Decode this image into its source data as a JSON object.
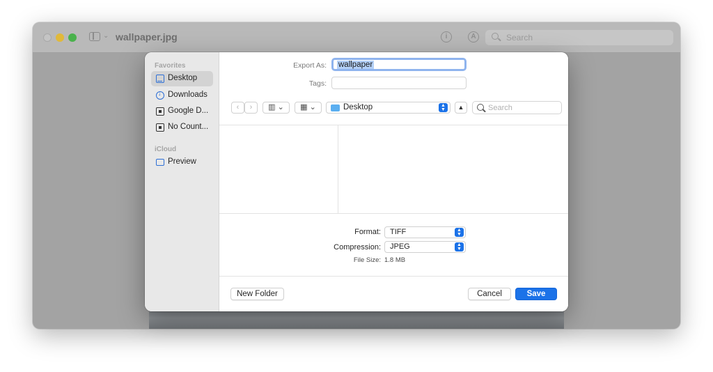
{
  "window": {
    "title": "wallpaper.jpg",
    "search_placeholder": "Search",
    "info_glyph": "i",
    "markup_glyph": "A"
  },
  "sidebar": {
    "favorites_heading": "Favorites",
    "items": [
      {
        "label": "Desktop",
        "icon": "desktop-icon",
        "selected": true
      },
      {
        "label": "Downloads",
        "icon": "downloads-icon"
      },
      {
        "label": "Google D...",
        "icon": "drive-icon"
      },
      {
        "label": "No Count...",
        "icon": "drive-icon"
      }
    ],
    "icloud_heading": "iCloud",
    "icloud_items": [
      {
        "label": "Preview",
        "icon": "folder-icon"
      }
    ]
  },
  "dialog": {
    "export_as_label": "Export As:",
    "export_as_value": "wallpaper",
    "tags_label": "Tags:",
    "location": "Desktop",
    "search_placeholder": "Search",
    "format_label": "Format:",
    "format_value": "TIFF",
    "compression_label": "Compression:",
    "compression_value": "JPEG",
    "file_size_label": "File Size:",
    "file_size_value": "1.8 MB",
    "new_folder_label": "New Folder",
    "cancel_label": "Cancel",
    "save_label": "Save"
  },
  "colors": {
    "accent": "#1b72e8",
    "selection": "#b3d0f7"
  }
}
